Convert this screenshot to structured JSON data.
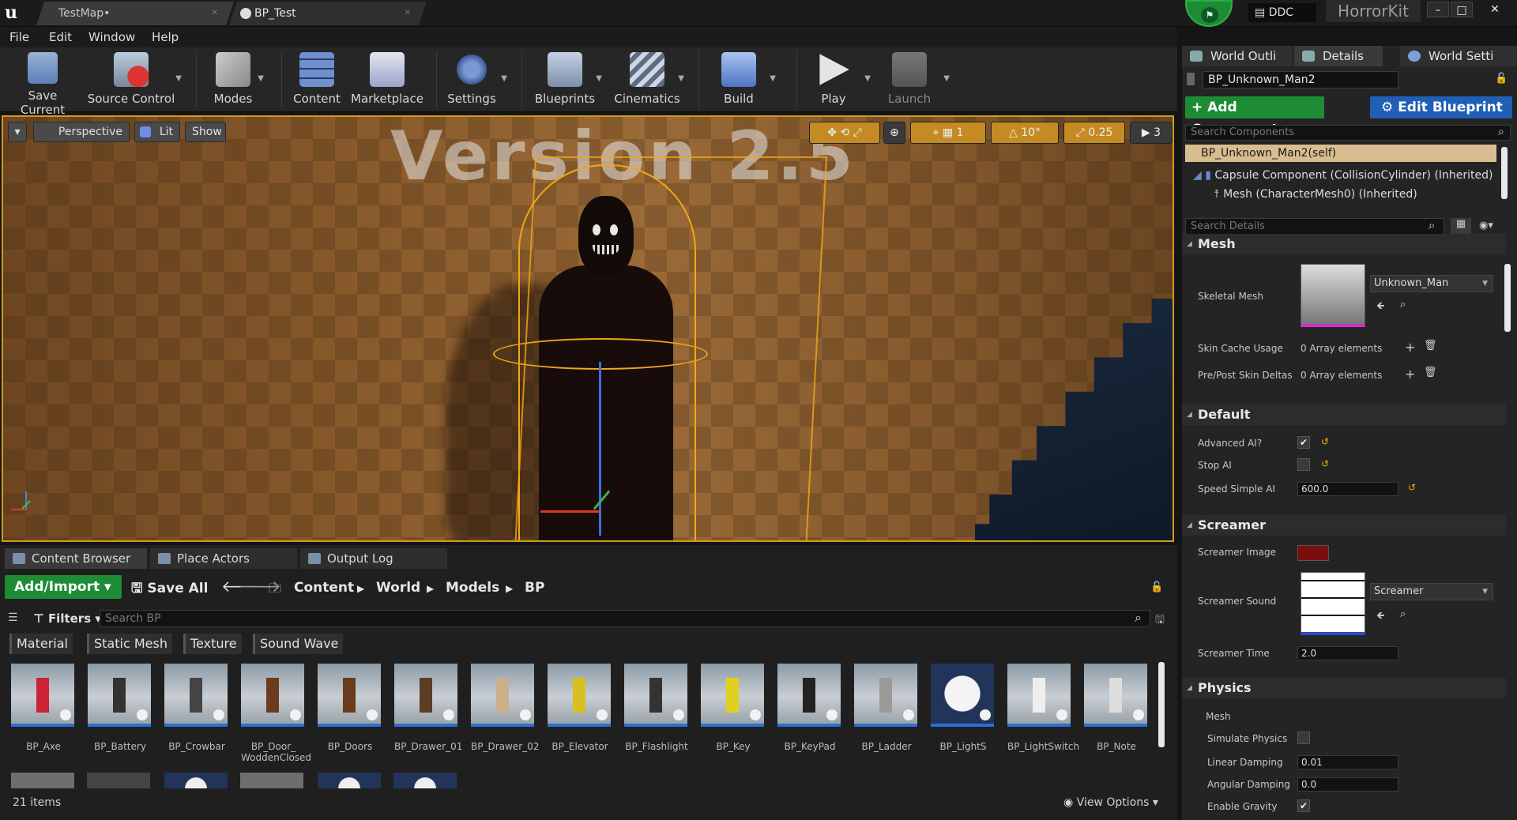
{
  "titlebar": {
    "tabs": [
      {
        "label": "TestMap•"
      },
      {
        "label": "BP_Test"
      }
    ],
    "ddc": "DDC",
    "kit": "HorrorKit",
    "win_minimize": "–",
    "win_maximize": "□",
    "win_close": "✕"
  },
  "menu": [
    "File",
    "Edit",
    "Window",
    "Help"
  ],
  "toolbar": [
    {
      "label": "Save Current",
      "icon": "floppy-icon"
    },
    {
      "label": "Source Control",
      "icon": "source-control-icon"
    },
    {
      "label": "Modes",
      "icon": "modes-tools-icon"
    },
    {
      "label": "Content",
      "icon": "content-grid-icon"
    },
    {
      "label": "Marketplace",
      "icon": "marketplace-icon"
    },
    {
      "label": "Settings",
      "icon": "settings-gears-icon"
    },
    {
      "label": "Blueprints",
      "icon": "blueprint-gamepad-icon"
    },
    {
      "label": "Cinematics",
      "icon": "clapperboard-icon"
    },
    {
      "label": "Build",
      "icon": "build-cubes-icon"
    },
    {
      "label": "Play",
      "icon": "play-icon"
    },
    {
      "label": "Launch",
      "icon": "launch-icon"
    }
  ],
  "viewport": {
    "perspective": "Perspective",
    "lit": "Lit",
    "show": "Show",
    "grid_snap": "1",
    "rotation_snap": "10°",
    "scale_snap": "0.25",
    "camera_speed": "3",
    "scene_text": "Version 2.5"
  },
  "right_panel": {
    "tabs": [
      "World Outli",
      "Details",
      "World Setti"
    ],
    "actor_name": "BP_Unknown_Man2",
    "add_component": "+ Add Component ▾",
    "edit_blueprint": "Edit Blueprint ▾",
    "search_components": "Search Components",
    "components": [
      "BP_Unknown_Man2(self)",
      "Capsule Component (CollisionCylinder) (Inherited)",
      "Mesh (CharacterMesh0) (Inherited)"
    ],
    "search_details": "Search Details",
    "sections": {
      "mesh": "Mesh",
      "default": "Default",
      "screamer": "Screamer",
      "physics": "Physics",
      "physics_mesh": "Mesh"
    },
    "props": {
      "skeletal_mesh_label": "Skeletal Mesh",
      "skeletal_mesh_value": "Unknown_Man",
      "skin_cache_label": "Skin Cache Usage",
      "skin_cache_value": "0 Array elements",
      "pre_post_label": "Pre/Post Skin Deltas",
      "pre_post_value": "0 Array elements",
      "advanced_ai_label": "Advanced AI?",
      "advanced_ai_checked": true,
      "stop_ai_label": "Stop AI",
      "stop_ai_checked": false,
      "speed_label": "Speed Simple AI",
      "speed_value": "600.0",
      "screamer_image_label": "Screamer Image",
      "screamer_sound_label": "Screamer Sound",
      "screamer_sound_value": "Screamer",
      "screamer_time_label": "Screamer Time",
      "screamer_time_value": "2.0",
      "simulate_physics_label": "Simulate Physics",
      "simulate_physics_checked": false,
      "linear_damping_label": "Linear Damping",
      "linear_damping_value": "0.01",
      "angular_damping_label": "Angular Damping",
      "angular_damping_value": "0.0",
      "enable_gravity_label": "Enable Gravity",
      "enable_gravity_checked": true
    }
  },
  "content_browser": {
    "tabs": [
      "Content Browser",
      "Place Actors",
      "Output Log"
    ],
    "add_import": "Add/Import ▾",
    "save_all": "Save All",
    "breadcrumb": [
      "Content",
      "World",
      "Models",
      "BP"
    ],
    "filters": "Filters ▾",
    "search_placeholder": "Search BP",
    "filter_tags": [
      "Material",
      "Static Mesh",
      "Texture",
      "Sound Wave"
    ],
    "assets": [
      "BP_Axe",
      "BP_Battery",
      "BP_Crowbar",
      "BP_Door_ WoddenClosed",
      "BP_Doors",
      "BP_Drawer_01",
      "BP_Drawer_02",
      "BP_Elevator",
      "BP_Flashlight",
      "BP_Key",
      "BP_KeyPad",
      "BP_Ladder",
      "BP_LightS",
      "BP_LightSwitch",
      "BP_Note"
    ],
    "item_count": "21 items",
    "view_options": "View Options ▾"
  }
}
